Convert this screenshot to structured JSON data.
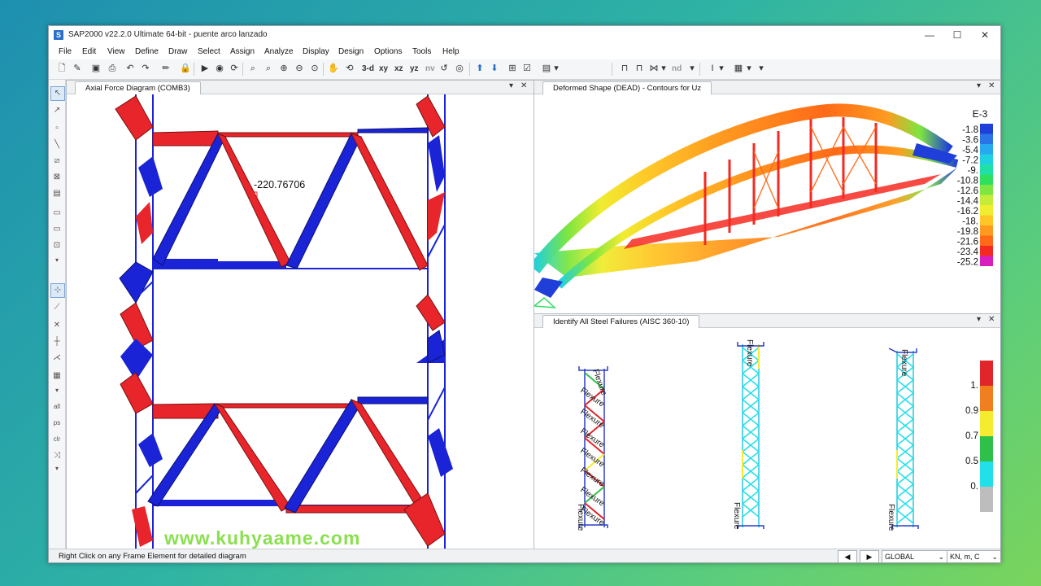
{
  "window": {
    "title": "SAP2000 v22.2.0 Ultimate 64-bit - puente arco lanzado",
    "icon_letter": "S",
    "controls": {
      "minimize": "—",
      "maximize": "☐",
      "close": "✕"
    }
  },
  "menu": [
    "File",
    "Edit",
    "View",
    "Define",
    "Draw",
    "Select",
    "Assign",
    "Analyze",
    "Display",
    "Design",
    "Options",
    "Tools",
    "Help"
  ],
  "toolbar": {
    "view_3d": "3-d",
    "view_xy": "xy",
    "view_xz": "xz",
    "view_yz": "yz",
    "view_nv": "nv",
    "nd": "nd"
  },
  "panels": {
    "axial": {
      "title": "Axial Force Diagram (COMB3)",
      "value_label": "-220.76706"
    },
    "deformed": {
      "title": "Deformed Shape (DEAD) - Contours for Uz",
      "legend_exp": "E-3",
      "legend_values": [
        "-1.8",
        "-3.6",
        "-5.4",
        "-7.2",
        "-9.",
        "-10.8",
        "-12.6",
        "-14.4",
        "-16.2",
        "-18.",
        "-19.8",
        "-21.6",
        "-23.4",
        "-25.2"
      ],
      "legend_colors": [
        "#1f3fd8",
        "#2a74e6",
        "#27a9ef",
        "#1fd0e0",
        "#1fe0a8",
        "#2fe060",
        "#7de640",
        "#c6ec3a",
        "#f0ec30",
        "#ffc628",
        "#ff9a20",
        "#ff6a18",
        "#f42a22",
        "#d81fbd"
      ]
    },
    "steel": {
      "title": "Identify All Steel Failures  (AISC 360-10)",
      "member_label": "Flexure",
      "legend_values": [
        "1.",
        "0.9",
        "0.7",
        "0.5",
        "0."
      ],
      "legend_colors": [
        "#e0262a",
        "#f07f20",
        "#f5ec30",
        "#2fc04a",
        "#22e0ea",
        "#bdbdbd"
      ]
    }
  },
  "status": {
    "message": "Right Click on any Frame Element for detailed diagram",
    "coord_system": "GLOBAL",
    "units": "KN, m, C"
  },
  "watermark": "www.kuhyaame.com"
}
